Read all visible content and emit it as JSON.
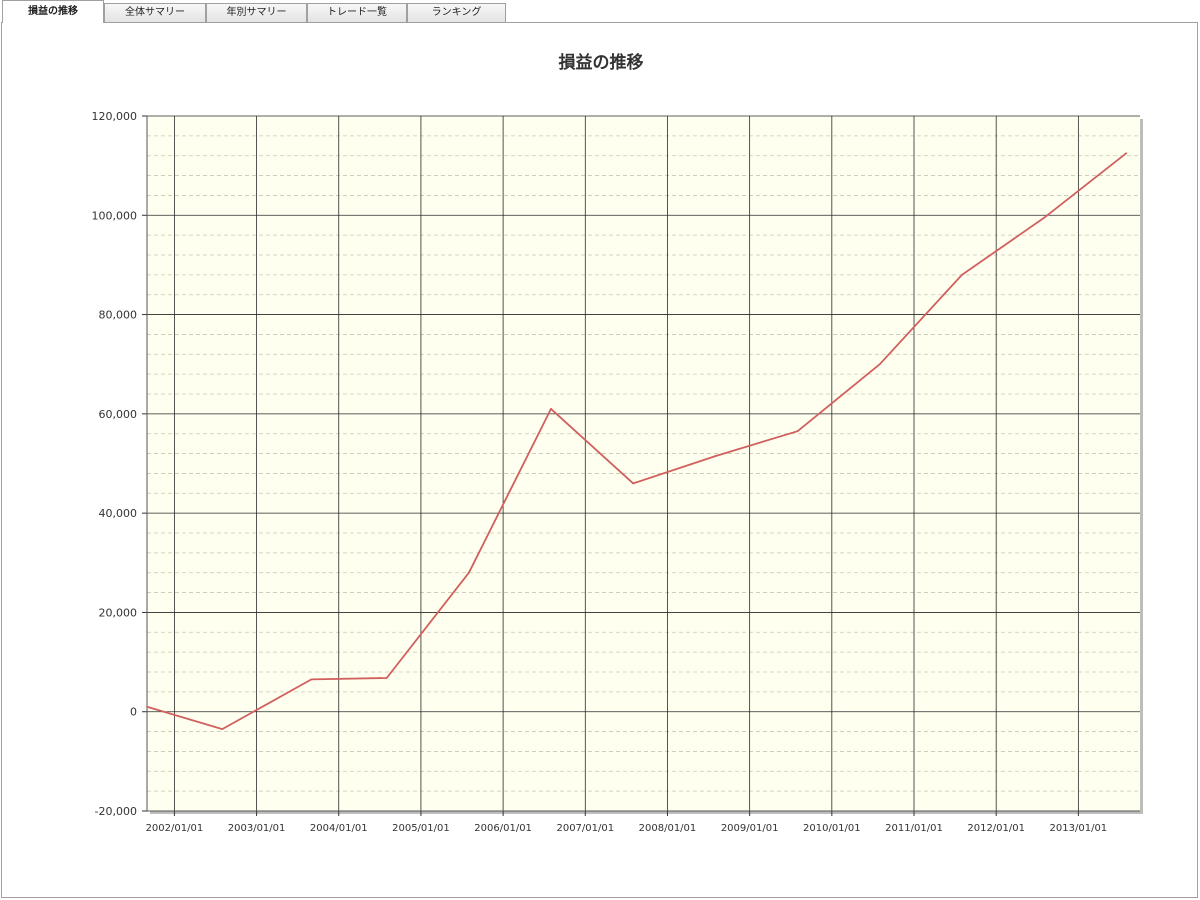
{
  "tabs": [
    {
      "label": "損益の推移",
      "active": true
    },
    {
      "label": "全体サマリー",
      "active": false
    },
    {
      "label": "年別サマリー",
      "active": false
    },
    {
      "label": "トレード一覧",
      "active": false
    },
    {
      "label": "ランキング",
      "active": false
    }
  ],
  "chart_data": {
    "type": "line",
    "title": "損益の推移",
    "xlabel": "",
    "ylabel": "",
    "ylim": [
      -20000,
      120000
    ],
    "y_ticks": [
      "120,000",
      "100,000",
      "80,000",
      "60,000",
      "40,000",
      "20,000",
      "0",
      "-20,000"
    ],
    "x_ticks": [
      "2002/01/01",
      "2003/01/01",
      "2004/01/01",
      "2005/01/01",
      "2006/01/01",
      "2007/01/01",
      "2008/01/01",
      "2009/01/01",
      "2010/01/01",
      "2011/01/01",
      "2012/01/01",
      "2013/01/01"
    ],
    "grid": true,
    "series": [
      {
        "color": "#d0605e",
        "x": [
          "2001/09",
          "2002/08",
          "2003/09",
          "2004/08",
          "2005/08",
          "2006/08",
          "2007/08",
          "2008/08",
          "2009/08",
          "2010/08",
          "2011/08",
          "2012/08",
          "2013/08"
        ],
        "values": [
          1000,
          -3500,
          6500,
          6800,
          28000,
          61000,
          46000,
          51500,
          56500,
          70000,
          88000,
          99500,
          112500
        ]
      }
    ],
    "colors": {
      "plot_bg": "#fffff0",
      "major_grid": "#2a2a2a",
      "minor_grid": "#c8c8b4",
      "line": "#d0605e"
    }
  }
}
